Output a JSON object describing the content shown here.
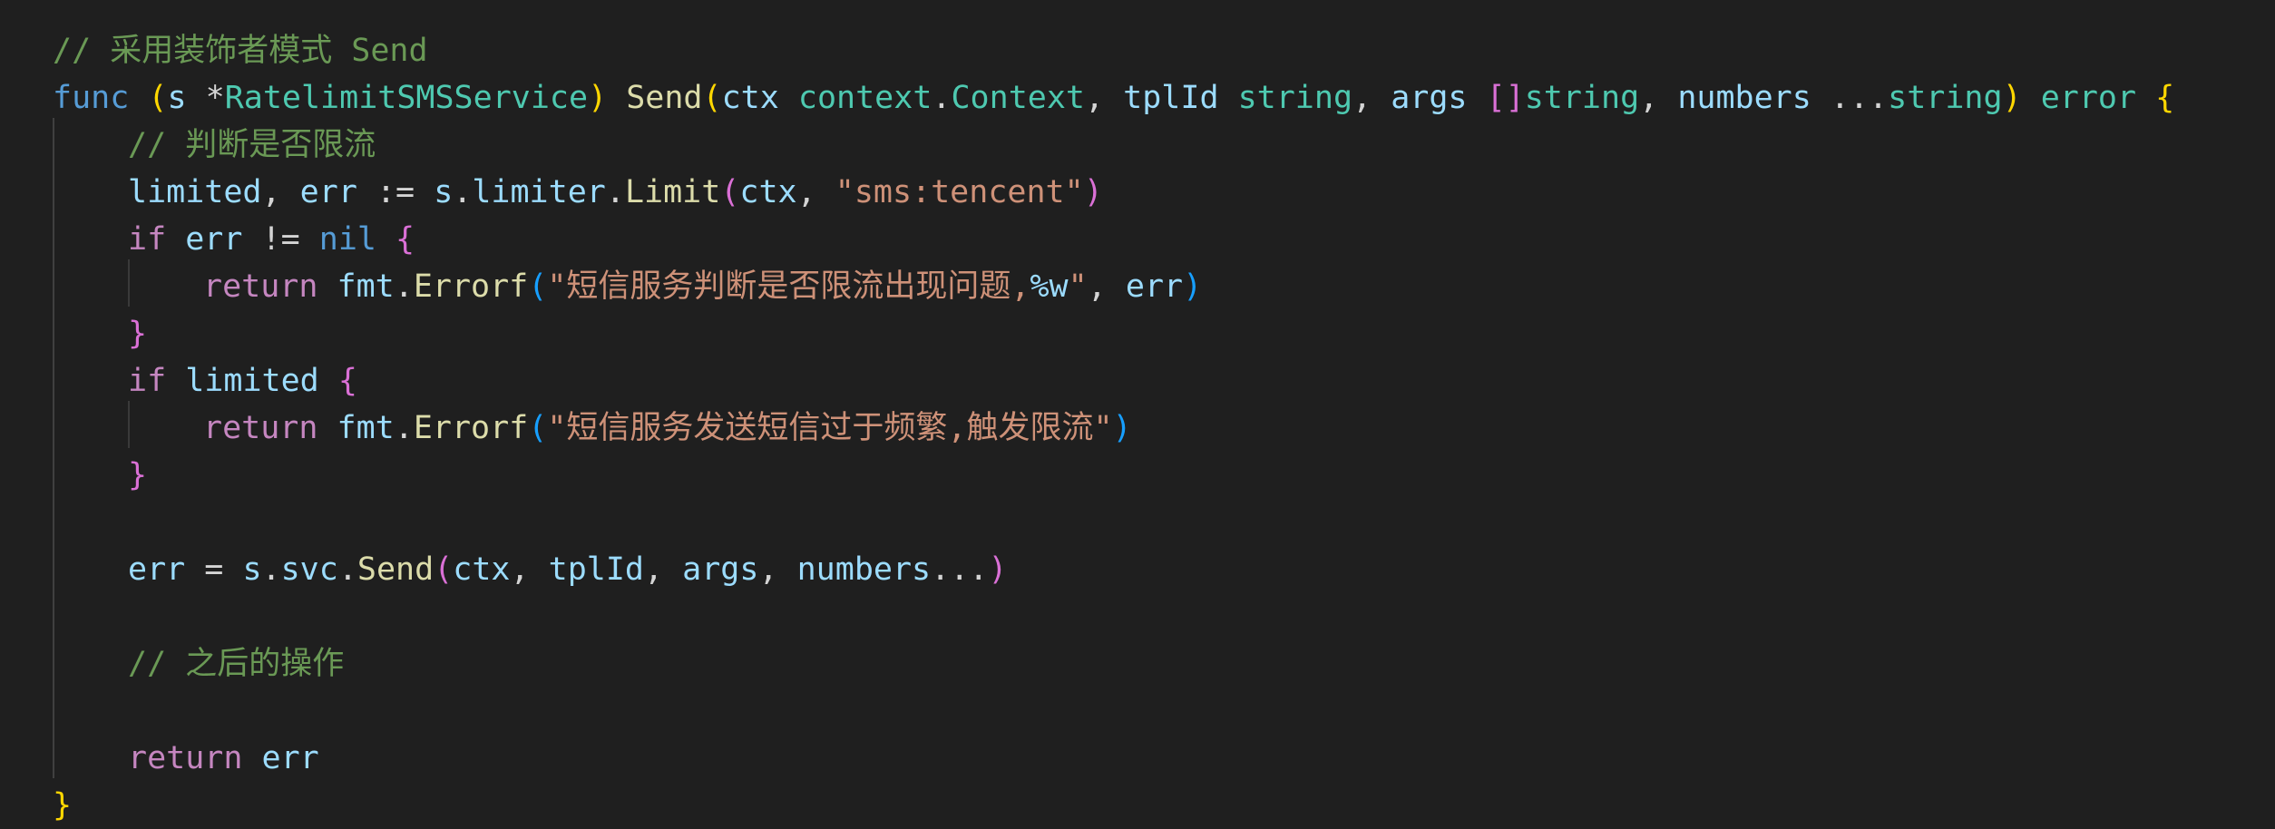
{
  "editor": {
    "colors": {
      "background": "#1f1f1f",
      "comment": "#6a9955",
      "keyword_blue": "#569cd6",
      "keyword_control": "#c586c0",
      "variable": "#9cdcfe",
      "type": "#4ec9b0",
      "function": "#dcdcaa",
      "string": "#ce9178",
      "bracket_level1": "#ffd700",
      "bracket_level2": "#da70d6",
      "bracket_level3": "#179fff"
    },
    "lines": [
      {
        "indent": 0,
        "tokens": [
          [
            "t-comment",
            "// 采用装饰者模式 Send"
          ]
        ]
      },
      {
        "indent": 0,
        "tokens": [
          [
            "t-kw-blue",
            "func"
          ],
          [
            "t-op",
            " "
          ],
          [
            "t-b1",
            "("
          ],
          [
            "t-var",
            "s"
          ],
          [
            "t-op",
            " *"
          ],
          [
            "t-type",
            "RatelimitSMSService"
          ],
          [
            "t-b1",
            ")"
          ],
          [
            "t-op",
            " "
          ],
          [
            "t-func",
            "Send"
          ],
          [
            "t-b1",
            "("
          ],
          [
            "t-var",
            "ctx"
          ],
          [
            "t-op",
            " "
          ],
          [
            "t-type",
            "context"
          ],
          [
            "t-op",
            "."
          ],
          [
            "t-type",
            "Context"
          ],
          [
            "t-op",
            ", "
          ],
          [
            "t-var",
            "tplId"
          ],
          [
            "t-op",
            " "
          ],
          [
            "t-type",
            "string"
          ],
          [
            "t-op",
            ", "
          ],
          [
            "t-var",
            "args"
          ],
          [
            "t-op",
            " "
          ],
          [
            "t-b2",
            "[]"
          ],
          [
            "t-type",
            "string"
          ],
          [
            "t-op",
            ", "
          ],
          [
            "t-var",
            "numbers"
          ],
          [
            "t-op",
            " ..."
          ],
          [
            "t-type",
            "string"
          ],
          [
            "t-b1",
            ")"
          ],
          [
            "t-op",
            " "
          ],
          [
            "t-type",
            "error"
          ],
          [
            "t-op",
            " "
          ],
          [
            "t-b1",
            "{"
          ]
        ]
      },
      {
        "indent": 1,
        "tokens": [
          [
            "t-comment",
            "// 判断是否限流"
          ]
        ]
      },
      {
        "indent": 1,
        "tokens": [
          [
            "t-var",
            "limited"
          ],
          [
            "t-op",
            ", "
          ],
          [
            "t-var",
            "err"
          ],
          [
            "t-op",
            " := "
          ],
          [
            "t-var",
            "s"
          ],
          [
            "t-op",
            "."
          ],
          [
            "t-var",
            "limiter"
          ],
          [
            "t-op",
            "."
          ],
          [
            "t-func",
            "Limit"
          ],
          [
            "t-b2",
            "("
          ],
          [
            "t-var",
            "ctx"
          ],
          [
            "t-op",
            ", "
          ],
          [
            "t-str",
            "\"sms:tencent\""
          ],
          [
            "t-b2",
            ")"
          ]
        ]
      },
      {
        "indent": 1,
        "tokens": [
          [
            "t-kw-pink",
            "if"
          ],
          [
            "t-op",
            " "
          ],
          [
            "t-var",
            "err"
          ],
          [
            "t-op",
            " != "
          ],
          [
            "t-kw-blue",
            "nil"
          ],
          [
            "t-op",
            " "
          ],
          [
            "t-b2",
            "{"
          ]
        ]
      },
      {
        "indent": 2,
        "tokens": [
          [
            "t-kw-pink",
            "return"
          ],
          [
            "t-op",
            " "
          ],
          [
            "t-var",
            "fmt"
          ],
          [
            "t-op",
            "."
          ],
          [
            "t-func",
            "Errorf"
          ],
          [
            "t-b3",
            "("
          ],
          [
            "t-str",
            "\"短信服务判断是否限流出现问题,"
          ],
          [
            "t-esc",
            "%w"
          ],
          [
            "t-str",
            "\""
          ],
          [
            "t-op",
            ", "
          ],
          [
            "t-var",
            "err"
          ],
          [
            "t-b3",
            ")"
          ]
        ]
      },
      {
        "indent": 1,
        "tokens": [
          [
            "t-b2",
            "}"
          ]
        ]
      },
      {
        "indent": 1,
        "tokens": [
          [
            "t-kw-pink",
            "if"
          ],
          [
            "t-op",
            " "
          ],
          [
            "t-var",
            "limited"
          ],
          [
            "t-op",
            " "
          ],
          [
            "t-b2",
            "{"
          ]
        ]
      },
      {
        "indent": 2,
        "tokens": [
          [
            "t-kw-pink",
            "return"
          ],
          [
            "t-op",
            " "
          ],
          [
            "t-var",
            "fmt"
          ],
          [
            "t-op",
            "."
          ],
          [
            "t-func",
            "Errorf"
          ],
          [
            "t-b3",
            "("
          ],
          [
            "t-str",
            "\"短信服务发送短信过于频繁,触发限流\""
          ],
          [
            "t-b3",
            ")"
          ]
        ]
      },
      {
        "indent": 1,
        "tokens": [
          [
            "t-b2",
            "}"
          ]
        ]
      },
      {
        "indent": 1,
        "tokens": []
      },
      {
        "indent": 1,
        "tokens": [
          [
            "t-var",
            "err"
          ],
          [
            "t-op",
            " = "
          ],
          [
            "t-var",
            "s"
          ],
          [
            "t-op",
            "."
          ],
          [
            "t-var",
            "svc"
          ],
          [
            "t-op",
            "."
          ],
          [
            "t-func",
            "Send"
          ],
          [
            "t-b2",
            "("
          ],
          [
            "t-var",
            "ctx"
          ],
          [
            "t-op",
            ", "
          ],
          [
            "t-var",
            "tplId"
          ],
          [
            "t-op",
            ", "
          ],
          [
            "t-var",
            "args"
          ],
          [
            "t-op",
            ", "
          ],
          [
            "t-var",
            "numbers"
          ],
          [
            "t-op",
            "..."
          ],
          [
            "t-b2",
            ")"
          ]
        ]
      },
      {
        "indent": 1,
        "tokens": []
      },
      {
        "indent": 1,
        "tokens": [
          [
            "t-comment",
            "// 之后的操作"
          ]
        ]
      },
      {
        "indent": 1,
        "tokens": []
      },
      {
        "indent": 1,
        "tokens": [
          [
            "t-kw-pink",
            "return"
          ],
          [
            "t-op",
            " "
          ],
          [
            "t-var",
            "err"
          ]
        ]
      },
      {
        "indent": 0,
        "tokens": [
          [
            "t-b1",
            "}"
          ]
        ]
      }
    ]
  }
}
